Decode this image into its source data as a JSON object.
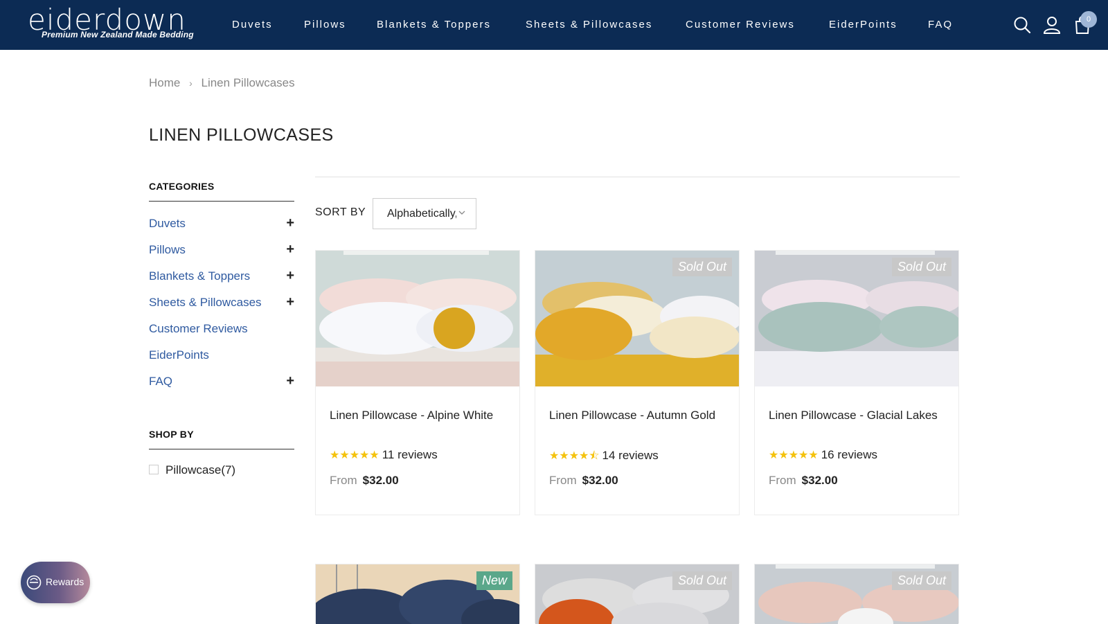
{
  "brand": {
    "name": "eiderdown",
    "tagline": "Premium New Zealand Made Bedding"
  },
  "nav": {
    "items": [
      "Duvets",
      "Pillows",
      "Blankets & Toppers",
      "Sheets & Pillowcases",
      "Customer Reviews",
      "EiderPoints",
      "FAQ"
    ]
  },
  "header_icons": [
    "search-icon",
    "user-icon",
    "cart-icon"
  ],
  "cart": {
    "count": "0"
  },
  "breadcrumb": {
    "home": "Home",
    "current": "Linen Pillowcases"
  },
  "page": {
    "title": "LINEN PILLOWCASES"
  },
  "sidebar": {
    "categories_heading": "CATEGORIES",
    "categories": [
      {
        "label": "Duvets",
        "expandable": true
      },
      {
        "label": "Pillows",
        "expandable": true
      },
      {
        "label": "Blankets & Toppers",
        "expandable": true
      },
      {
        "label": "Sheets & Pillowcases",
        "expandable": true
      },
      {
        "label": "Customer Reviews",
        "expandable": false
      },
      {
        "label": "EiderPoints",
        "expandable": false
      },
      {
        "label": "FAQ",
        "expandable": true
      }
    ],
    "expand_symbol": "+",
    "shop_by_heading": "SHOP BY",
    "filters": [
      {
        "label": "Pillowcase",
        "count": "(7)"
      }
    ]
  },
  "sort": {
    "label": "SORT BY",
    "value": "Alphabetically, A-Z"
  },
  "products": [
    {
      "title": "Linen Pillowcase - Alpine White",
      "rating": 5.0,
      "reviews": "11 reviews",
      "from": "From",
      "price": "$32.00",
      "badge": ""
    },
    {
      "title": "Linen Pillowcase - Autumn Gold",
      "rating": 4.5,
      "reviews": "14 reviews",
      "from": "From",
      "price": "$32.00",
      "badge": "Sold Out"
    },
    {
      "title": "Linen Pillowcase - Glacial Lakes",
      "rating": 5.0,
      "reviews": "16 reviews",
      "from": "From",
      "price": "$32.00",
      "badge": "Sold Out"
    }
  ],
  "products_row2_badges": [
    "New",
    "Sold Out",
    "Sold Out"
  ],
  "rewards": {
    "label": "Rewards"
  },
  "colors": {
    "header_bg": "#0c2b54",
    "link_blue": "#2f5aa0",
    "star_yellow": "#f4c20d",
    "badge_sold": "#c8c8c8",
    "badge_new": "#5aa78a"
  }
}
